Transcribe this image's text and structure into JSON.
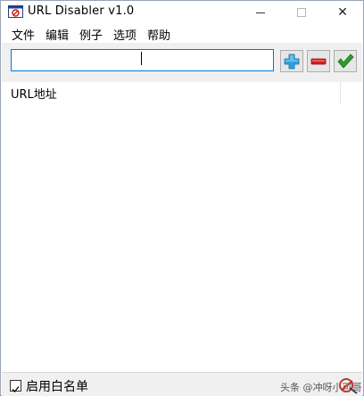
{
  "window": {
    "title": "URL Disabler v1.0",
    "close_glyph": "✕"
  },
  "menu": {
    "items": [
      {
        "label": "文件"
      },
      {
        "label": "编辑"
      },
      {
        "label": "例子"
      },
      {
        "label": "选项"
      },
      {
        "label": "帮助"
      }
    ]
  },
  "toolbar": {
    "url_input_value": "",
    "add_icon": "plus-icon",
    "remove_icon": "minus-icon",
    "confirm_icon": "checkmark-icon"
  },
  "list": {
    "column_header": "URL地址",
    "rows": []
  },
  "footer": {
    "whitelist_label": "启用白名单",
    "whitelist_checked": true,
    "watermark": "头条 @冲呀小可哥"
  },
  "colors": {
    "accent": "#0078d7",
    "add": "#2aa3e0",
    "remove": "#d42020",
    "confirm": "#2f9e2a"
  }
}
